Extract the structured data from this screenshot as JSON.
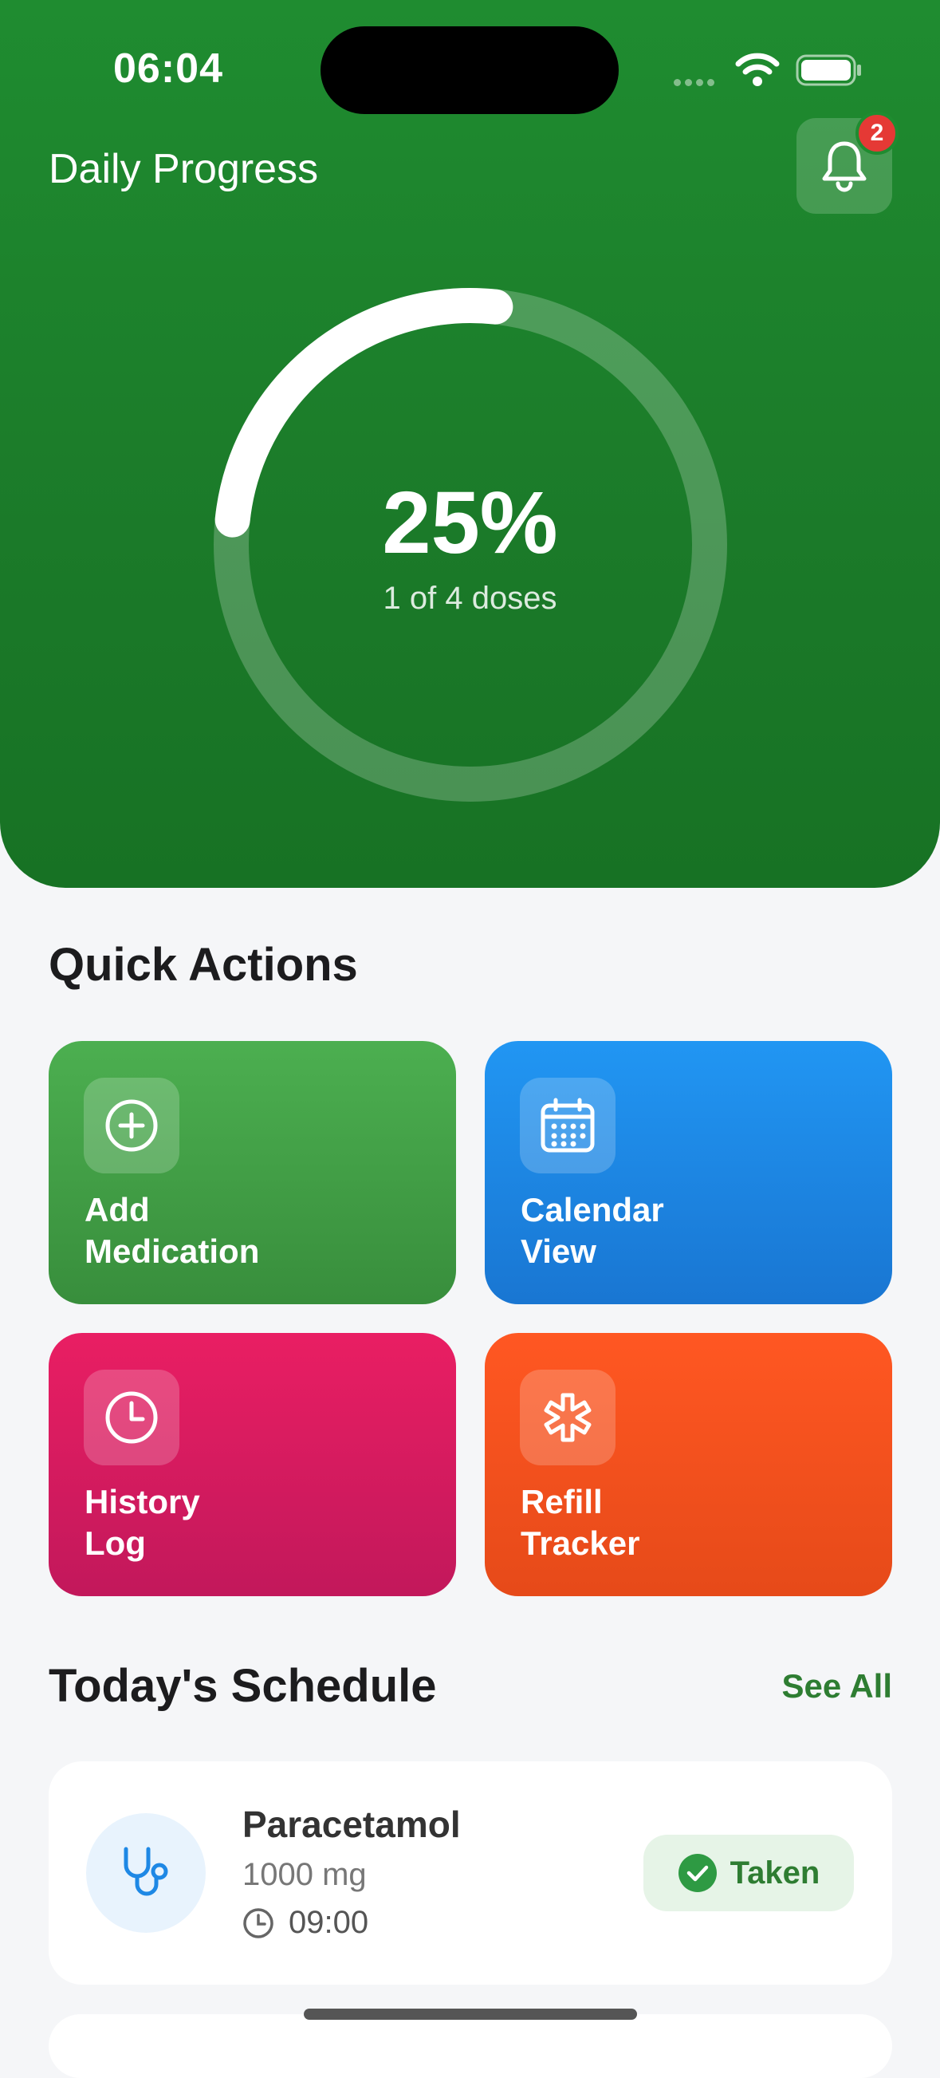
{
  "status_bar": {
    "time": "06:04"
  },
  "header": {
    "title": "Daily Progress",
    "notification_count": "2",
    "bell_icon": "bell-icon"
  },
  "progress": {
    "percent_label": "25%",
    "percent_value": 0.25,
    "subtitle": "1 of 4 doses"
  },
  "quick_actions": {
    "title": "Quick Actions",
    "items": [
      {
        "label": "Add\nMedication",
        "icon": "plus-circle-icon",
        "color": "#43a047"
      },
      {
        "label": "Calendar\nView",
        "icon": "calendar-icon",
        "color": "#1e88e5"
      },
      {
        "label": "History\nLog",
        "icon": "clock-icon",
        "color": "#d81b60"
      },
      {
        "label": "Refill\nTracker",
        "icon": "asterisk-icon",
        "color": "#f4511e"
      }
    ]
  },
  "schedule": {
    "title": "Today's Schedule",
    "see_all": "See All",
    "items": [
      {
        "name": "Paracetamol",
        "dose": "1000 mg",
        "time": "09:00",
        "status": "Taken",
        "icon": "stethoscope-icon"
      }
    ]
  },
  "colors": {
    "hero_green": "#1f8c30",
    "accent_green": "#2e7d32",
    "badge_red": "#e53935"
  }
}
